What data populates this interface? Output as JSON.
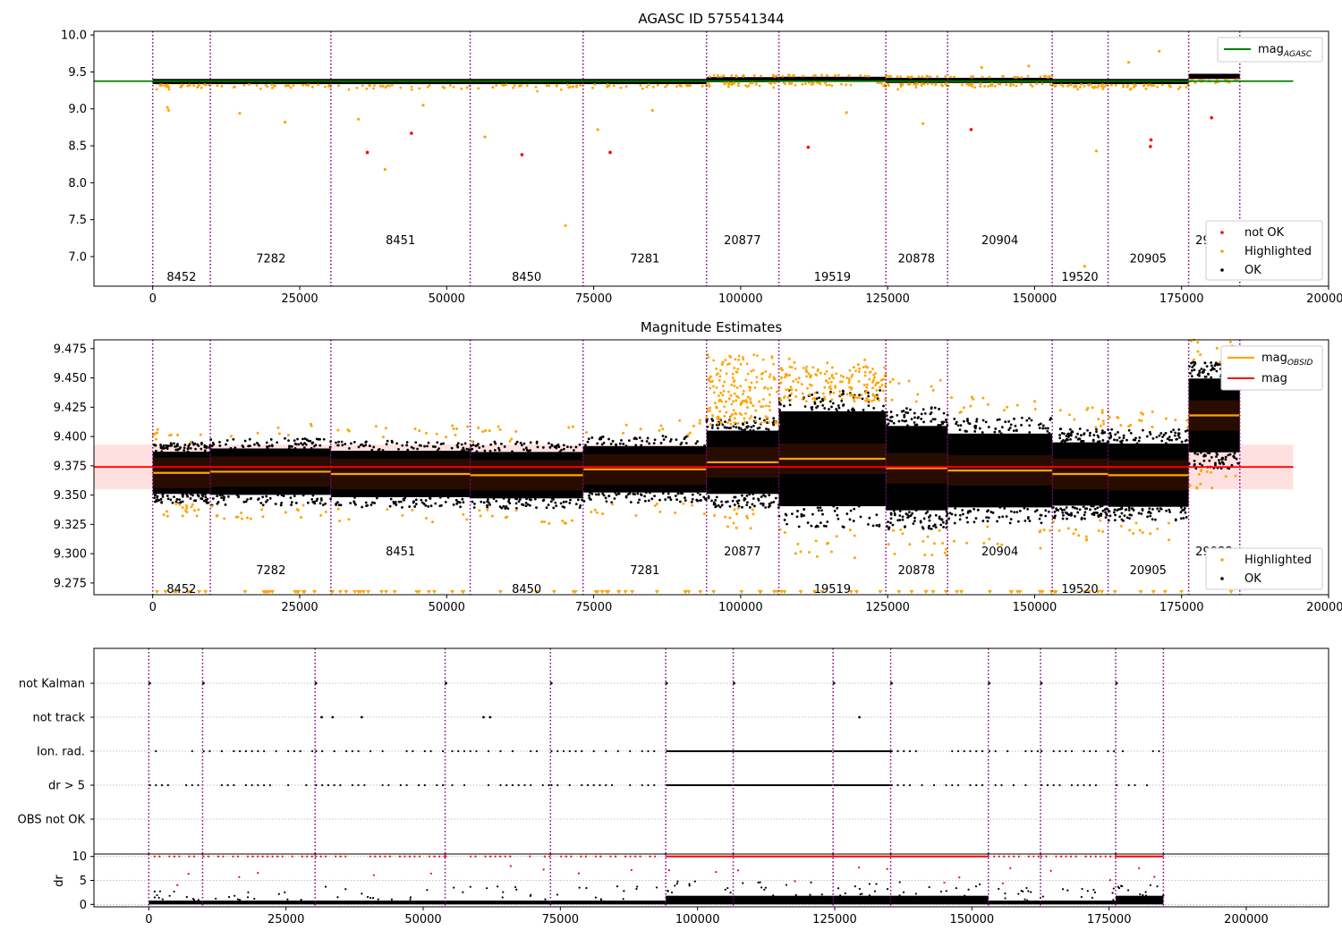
{
  "colors": {
    "ok": "#000000",
    "highlighted": "#ffa500",
    "not_ok": "#ff0000",
    "mag_agasc_line": "#008000",
    "mag_obsid_line": "#ffa500",
    "mag_line": "#ff0000",
    "obs_boundary": "#800080",
    "grid": "#b0b0b0"
  },
  "chart_data": [
    {
      "type": "scatter",
      "title": "AGASC ID 575541344",
      "xlim": [
        -10000,
        200000
      ],
      "ylim": [
        6.6,
        10.05
      ],
      "xticks": [
        0,
        25000,
        50000,
        75000,
        100000,
        125000,
        150000,
        175000,
        200000
      ],
      "yticks": [
        7.0,
        7.5,
        8.0,
        8.5,
        9.0,
        9.5,
        10.0
      ],
      "mag_agasc": 9.375,
      "mag_agasc_line_x": [
        -10000,
        194000
      ],
      "obs_boundaries": [
        0,
        9800,
        30300,
        54000,
        73200,
        94200,
        106500,
        124700,
        135200,
        153000,
        162500,
        176200,
        184900
      ],
      "obs_labels": [
        {
          "obsid": "8452",
          "x": 4900,
          "y": 6.72
        },
        {
          "obsid": "7282",
          "x": 20100,
          "y": 6.97
        },
        {
          "obsid": "8451",
          "x": 42150,
          "y": 7.22
        },
        {
          "obsid": "8450",
          "x": 63600,
          "y": 6.72
        },
        {
          "obsid": "7281",
          "x": 83700,
          "y": 6.97
        },
        {
          "obsid": "20877",
          "x": 100300,
          "y": 7.22
        },
        {
          "obsid": "19519",
          "x": 115600,
          "y": 6.72
        },
        {
          "obsid": "20878",
          "x": 129900,
          "y": 6.97
        },
        {
          "obsid": "20904",
          "x": 144100,
          "y": 7.22
        },
        {
          "obsid": "19520",
          "x": 157700,
          "y": 6.72
        },
        {
          "obsid": "20905",
          "x": 169300,
          "y": 6.97
        },
        {
          "obsid": "29988",
          "x": 180500,
          "y": 7.22
        }
      ],
      "not_ok_points": [
        [
          36500,
          8.41
        ],
        [
          44000,
          8.67
        ],
        [
          62800,
          8.38
        ],
        [
          77800,
          8.41
        ],
        [
          111500,
          8.48
        ],
        [
          139200,
          8.72
        ],
        [
          169800,
          8.58
        ],
        [
          169700,
          8.49
        ],
        [
          180100,
          8.88
        ]
      ],
      "highlighted_outliers": [
        [
          2500,
          9.02
        ],
        [
          2700,
          8.98
        ],
        [
          14800,
          8.94
        ],
        [
          22500,
          8.82
        ],
        [
          39500,
          8.18
        ],
        [
          56500,
          8.62
        ],
        [
          70200,
          7.42
        ],
        [
          75700,
          8.72
        ],
        [
          160500,
          8.43
        ],
        [
          158500,
          6.87
        ],
        [
          171200,
          9.78
        ],
        [
          166000,
          9.63
        ],
        [
          149000,
          9.58
        ],
        [
          141000,
          9.56
        ],
        [
          35000,
          8.86
        ],
        [
          46000,
          9.05
        ],
        [
          85000,
          8.98
        ],
        [
          118000,
          8.95
        ],
        [
          131000,
          8.8
        ]
      ],
      "legend": {
        "placement": "lower right",
        "entries": [
          "not OK",
          "Highlighted",
          "OK"
        ]
      },
      "line_legend": {
        "placement": "upper right",
        "base": "mag",
        "sub": "AGASC"
      }
    },
    {
      "type": "scatter",
      "title": "Magnitude Estimates",
      "xlim": [
        -10000,
        200000
      ],
      "ylim": [
        9.265,
        9.4825
      ],
      "xticks": [
        0,
        25000,
        50000,
        75000,
        100000,
        125000,
        150000,
        175000,
        200000
      ],
      "yticks": [
        9.275,
        9.3,
        9.325,
        9.35,
        9.375,
        9.4,
        9.425,
        9.45,
        9.475
      ],
      "mag": 9.374,
      "mag_band": [
        9.355,
        9.393
      ],
      "mag_line_x": [
        -10000,
        194000
      ],
      "obs_boundaries": [
        0,
        9800,
        30300,
        54000,
        73200,
        94200,
        106500,
        124700,
        135200,
        153000,
        162500,
        176200,
        184900
      ],
      "mag_obsid": [
        9.369,
        9.37,
        9.368,
        9.367,
        9.372,
        9.378,
        9.381,
        9.373,
        9.371,
        9.368,
        9.367,
        9.418
      ],
      "obs_labels": [
        {
          "obsid": "8452",
          "x": 4900,
          "y": 9.2695
        },
        {
          "obsid": "7282",
          "x": 20100,
          "y": 9.2855
        },
        {
          "obsid": "8451",
          "x": 42150,
          "y": 9.3015
        },
        {
          "obsid": "8450",
          "x": 63600,
          "y": 9.2695
        },
        {
          "obsid": "7281",
          "x": 83700,
          "y": 9.2855
        },
        {
          "obsid": "20877",
          "x": 100300,
          "y": 9.3015
        },
        {
          "obsid": "19519",
          "x": 115600,
          "y": 9.2695
        },
        {
          "obsid": "20878",
          "x": 129900,
          "y": 9.2855
        },
        {
          "obsid": "20904",
          "x": 144100,
          "y": 9.3015
        },
        {
          "obsid": "19520",
          "x": 157700,
          "y": 9.2695
        },
        {
          "obsid": "20905",
          "x": 169300,
          "y": 9.2855
        },
        {
          "obsid": "29988",
          "x": 180500,
          "y": 9.3015
        }
      ],
      "legend_points": {
        "placement": "lower right",
        "entries": [
          "Highlighted",
          "OK"
        ]
      },
      "legend_lines": {
        "placement": "upper right",
        "obsid_base": "mag",
        "obsid_sub": "OBSID",
        "mag": "mag"
      }
    },
    {
      "type": "scatter",
      "title": "",
      "xlim": [
        -10000,
        215000
      ],
      "categories": [
        "not Kalman",
        "not track",
        "Ion. rad.",
        "dr > 5",
        "OBS not OK"
      ],
      "not_track_points": [
        31500,
        33500,
        38800,
        61000,
        62200,
        129500
      ],
      "obs_boundaries": [
        0,
        9800,
        30300,
        54000,
        73200,
        94200,
        106500,
        124700,
        135200,
        153000,
        162500,
        176200,
        184900
      ]
    },
    {
      "type": "scatter",
      "title": "",
      "ylabel": "dr",
      "xlim": [
        -10000,
        215000
      ],
      "ylim": [
        -0.5,
        10.5
      ],
      "xticks": [
        0,
        25000,
        50000,
        75000,
        100000,
        125000,
        150000,
        175000,
        200000
      ],
      "yticks": [
        0,
        5,
        10
      ],
      "dr_cap": 10,
      "obs_boundaries": [
        0,
        9800,
        30300,
        54000,
        73200,
        94200,
        106500,
        124700,
        135200,
        153000,
        162500,
        176200,
        184900
      ]
    }
  ]
}
